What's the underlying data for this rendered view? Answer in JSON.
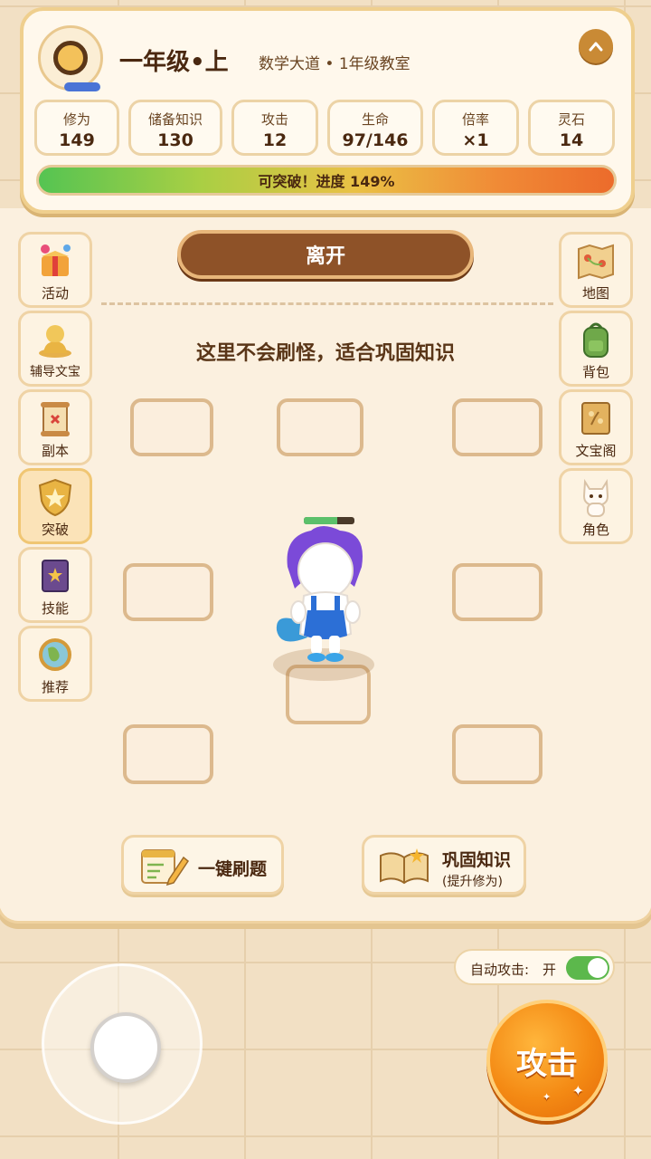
{
  "header": {
    "grade": "一年级•上",
    "classroom": "数学大道 • 1年级教室",
    "collapse_icon": "chevron-up-icon"
  },
  "stats": [
    {
      "label": "修为",
      "value": "149"
    },
    {
      "label": "储备知识",
      "value": "130"
    },
    {
      "label": "攻击",
      "value": "12"
    },
    {
      "label": "生命",
      "value": "97/146"
    },
    {
      "label": "倍率",
      "value": "×1"
    },
    {
      "label": "灵石",
      "value": "14"
    }
  ],
  "progress": {
    "text": "可突破！进度 149%",
    "percent": 149
  },
  "board": {
    "leave_label": "离开",
    "notice": "这里不会刷怪，适合巩固知识"
  },
  "left_menu": [
    {
      "label": "活动",
      "icon": "gift-icon"
    },
    {
      "label": "辅导文宝",
      "icon": "tutor-icon"
    },
    {
      "label": "副本",
      "icon": "scroll-icon"
    },
    {
      "label": "突破",
      "icon": "shield-star-icon",
      "active": true
    },
    {
      "label": "技能",
      "icon": "spellbook-icon"
    },
    {
      "label": "推荐",
      "icon": "globe-icon"
    }
  ],
  "right_menu": [
    {
      "label": "地图",
      "icon": "map-icon"
    },
    {
      "label": "背包",
      "icon": "backpack-icon"
    },
    {
      "label": "文宝阁",
      "icon": "treasure-book-icon"
    },
    {
      "label": "角色",
      "icon": "cat-icon"
    }
  ],
  "player": {
    "hp_fraction": 0.66
  },
  "actions": {
    "quiz_label": "一键刷题",
    "consolidate_label": "巩固知识",
    "consolidate_sub": "(提升修为)"
  },
  "auto_attack": {
    "label": "自动攻击:",
    "value": "开",
    "enabled": true
  },
  "attack_label": "攻击",
  "colors": {
    "accent": "#8e5228",
    "attack": "#f48a14",
    "toggle_on": "#5cb84c"
  }
}
